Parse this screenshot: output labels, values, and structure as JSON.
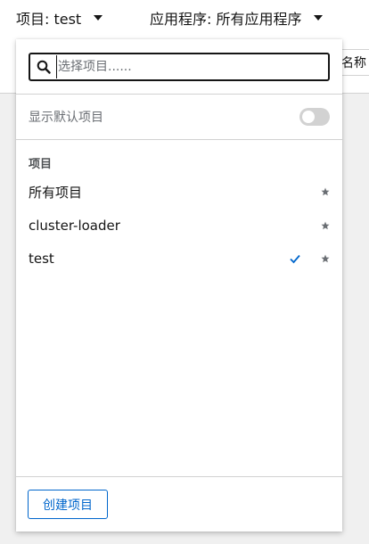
{
  "topbar": {
    "project_selector_label": "项目: test",
    "app_selector_label": "应用程序: 所有应用程序"
  },
  "background": {
    "name_button_label": "名称"
  },
  "dropdown": {
    "search": {
      "value": "",
      "placeholder": "选择项目......"
    },
    "default_toggle_label": "显示默认项目",
    "default_toggle_on": false,
    "group_title": "项目",
    "items": [
      {
        "label": "所有项目",
        "selected": false
      },
      {
        "label": "cluster-loader",
        "selected": false
      },
      {
        "label": "test",
        "selected": true
      }
    ],
    "create_button_label": "创建项目"
  },
  "colors": {
    "accent": "#0066cc",
    "star": "#6a6e73",
    "toggle_off": "#d2d2d2"
  }
}
